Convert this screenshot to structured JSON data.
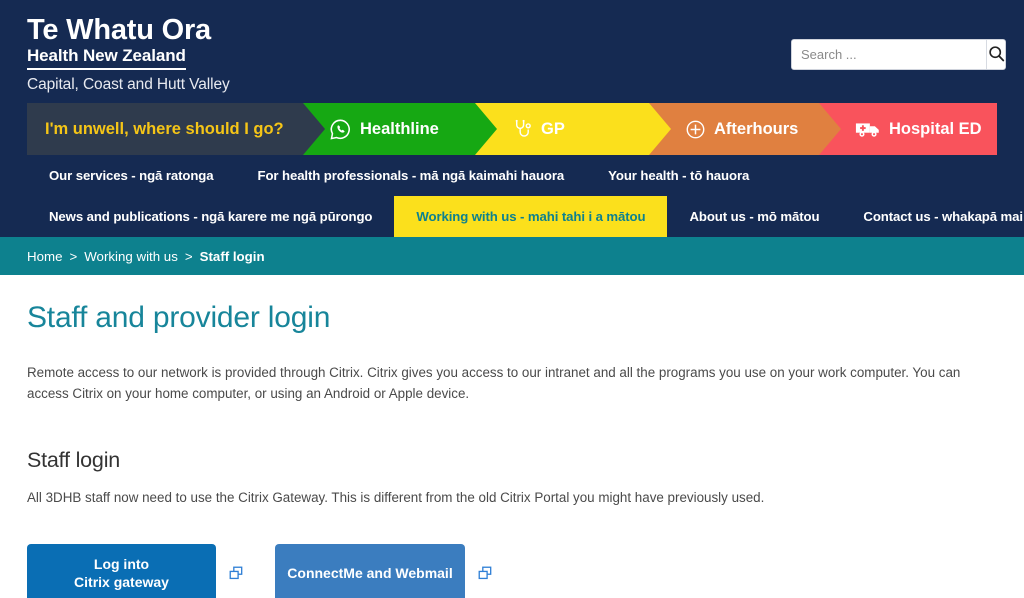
{
  "header": {
    "logo_line1": "Te Whatu Ora",
    "logo_line2": "Health New Zealand",
    "logo_line3": "Capital, Coast and Hutt Valley",
    "search": {
      "placeholder": "Search ...",
      "value": "",
      "icon": "search-icon",
      "button_label": ""
    }
  },
  "banner": {
    "items": [
      {
        "label": "I'm unwell, where should I go?",
        "icon": "",
        "bg": "#2f3b4d",
        "color": "#f5c517"
      },
      {
        "label": "Healthline",
        "icon": "phone-bubble-icon",
        "bg": "#16a813",
        "color": "#ffffff"
      },
      {
        "label": "GP",
        "icon": "stethoscope-icon",
        "bg": "#fbe01c",
        "color": "#ffffff"
      },
      {
        "label": "Afterhours",
        "icon": "plus-circle-icon",
        "bg": "#e08040",
        "color": "#ffffff"
      },
      {
        "label": "Hospital ED",
        "icon": "ambulance-icon",
        "bg": "#f9535c",
        "color": "#ffffff"
      }
    ]
  },
  "nav": {
    "row1": [
      {
        "label": "Our services - ngā ratonga",
        "active": false
      },
      {
        "label": "For health professionals - mā ngā kaimahi hauora",
        "active": false
      },
      {
        "label": "Your health - tō hauora",
        "active": false
      }
    ],
    "row2": [
      {
        "label": "News and publications - ngā karere me ngā pūrongo",
        "active": false
      },
      {
        "label": "Working with us - mahi tahi i a mātou",
        "active": true
      },
      {
        "label": "About us - mō mātou",
        "active": false
      },
      {
        "label": "Contact us - whakapā mai",
        "active": false
      }
    ]
  },
  "breadcrumb": {
    "items": [
      "Home",
      "Working with us",
      "Staff login"
    ],
    "separator": ">"
  },
  "main": {
    "page_title": "Staff and provider login",
    "intro": "Remote access to our network is provided through Citrix. Citrix gives you access to our intranet and all the programs you use on your work computer. You can access Citrix on your home computer, or using an Android or Apple device.",
    "section_title": "Staff login",
    "section_text": "All 3DHB staff now need to use the Citrix Gateway. This is different from the old Citrix Portal you might have previously used.",
    "buttons": [
      {
        "label": "Log into\nCitrix gateway",
        "bg": "#0a6eb4",
        "external_icon": "external-link-icon"
      },
      {
        "label": "ConnectMe and Webmail",
        "bg": "#3b7dbf",
        "external_icon": "external-link-icon"
      }
    ]
  },
  "colors": {
    "navy": "#152a52",
    "teal": "#0d818e",
    "title_teal": "#17859a",
    "yellow": "#fbe01c",
    "green": "#16a813",
    "orange": "#e08040",
    "red": "#f9535c",
    "slate": "#2f3b4d"
  }
}
